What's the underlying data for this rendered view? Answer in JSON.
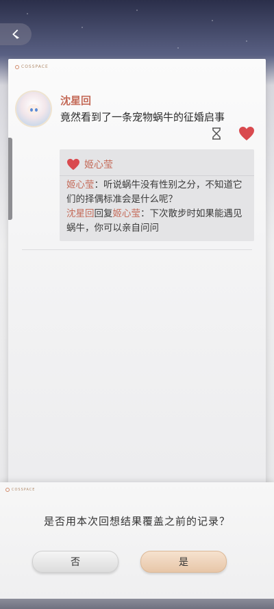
{
  "header": {
    "back_icon": "chevron-left-icon"
  },
  "card": {
    "logo_text": "COSSPACE",
    "post": {
      "author": "沈星回",
      "text": "竟然看到了一条宠物蜗牛的征婚启事",
      "icons": [
        "hourglass-icon",
        "heart-icon"
      ]
    },
    "likes": {
      "name": "姬心莹"
    },
    "comments": [
      {
        "author": "姬心莹",
        "separator": "：",
        "text": "听说蜗牛没有性别之分，不知道它们的择偶标准会是什么呢？"
      },
      {
        "author": "沈星回",
        "reply_word": "回复",
        "reply_to": "姬心莹",
        "separator": "：",
        "text": "下次散步时如果能遇见蜗牛，你可以亲自问问"
      }
    ]
  },
  "dialog": {
    "logo_text": "COSSPACE",
    "question": "是否用本次回想结果覆盖之前的记录？",
    "no_label": "否",
    "yes_label": "是"
  },
  "colors": {
    "accent": "#c46a58",
    "heart": "#d94a4f",
    "yes_button": "#e7c6a8"
  }
}
